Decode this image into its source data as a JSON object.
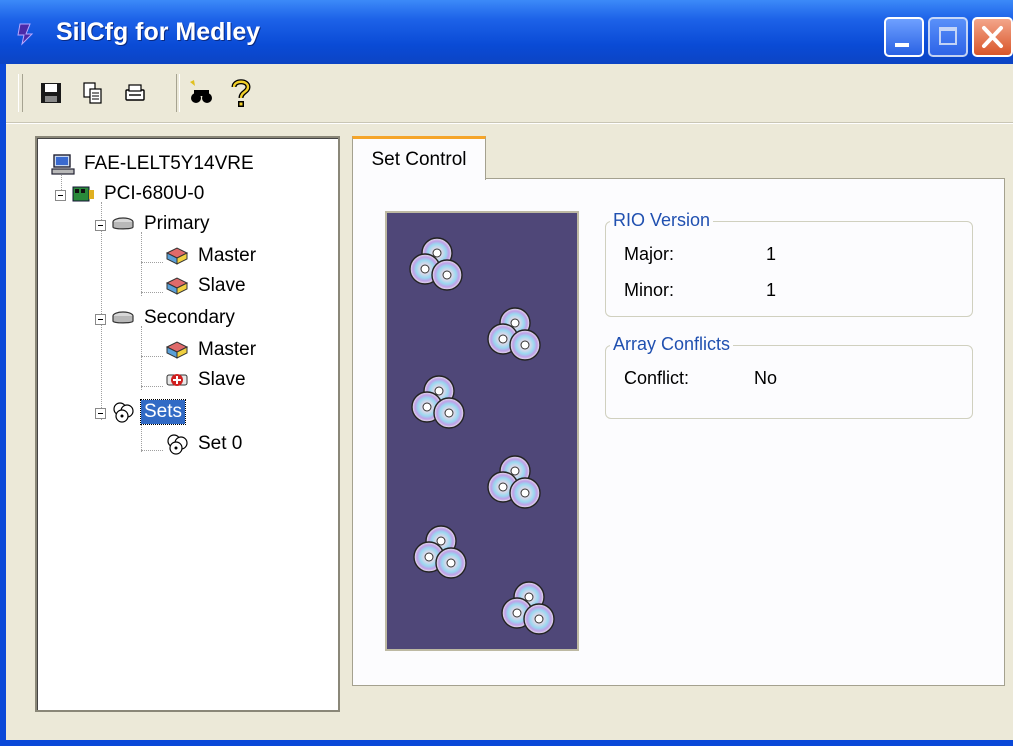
{
  "window": {
    "title": "SilCfg for Medley",
    "controls": [
      "minimize",
      "maximize",
      "close"
    ]
  },
  "toolbar": {
    "buttons": [
      {
        "name": "save",
        "icon": "floppy-disk-icon"
      },
      {
        "name": "copy",
        "icon": "copy-icon"
      },
      {
        "name": "print",
        "icon": "printer-icon"
      },
      {
        "name": "find",
        "icon": "binoculars-icon"
      },
      {
        "name": "help",
        "icon": "question-mark-icon"
      }
    ]
  },
  "tree": {
    "computer": "FAE-LELT5Y14VRE",
    "controller": "PCI-680U-0",
    "primary": {
      "label": "Primary",
      "master": "Master",
      "slave": "Slave"
    },
    "secondary": {
      "label": "Secondary",
      "master": "Master",
      "slave": "Slave"
    },
    "sets": {
      "label": "Sets",
      "set0": "Set 0"
    },
    "selected": "Sets"
  },
  "tabs": [
    {
      "label": "Set Control",
      "active": true
    }
  ],
  "rio_version": {
    "title": "RIO Version",
    "major_label": "Major:",
    "major_value": "1",
    "minor_label": "Minor:",
    "minor_value": "1"
  },
  "array_conflicts": {
    "title": "Array Conflicts",
    "conflict_label": "Conflict:",
    "conflict_value": "No"
  },
  "colors": {
    "title_bar": "#0a4bd6",
    "window_bg": "#ece9d8",
    "cd_panel_bg": "#4f4778",
    "group_title": "#2050b0",
    "tab_highlight": "#f5a52a",
    "selection": "#316ac5"
  }
}
